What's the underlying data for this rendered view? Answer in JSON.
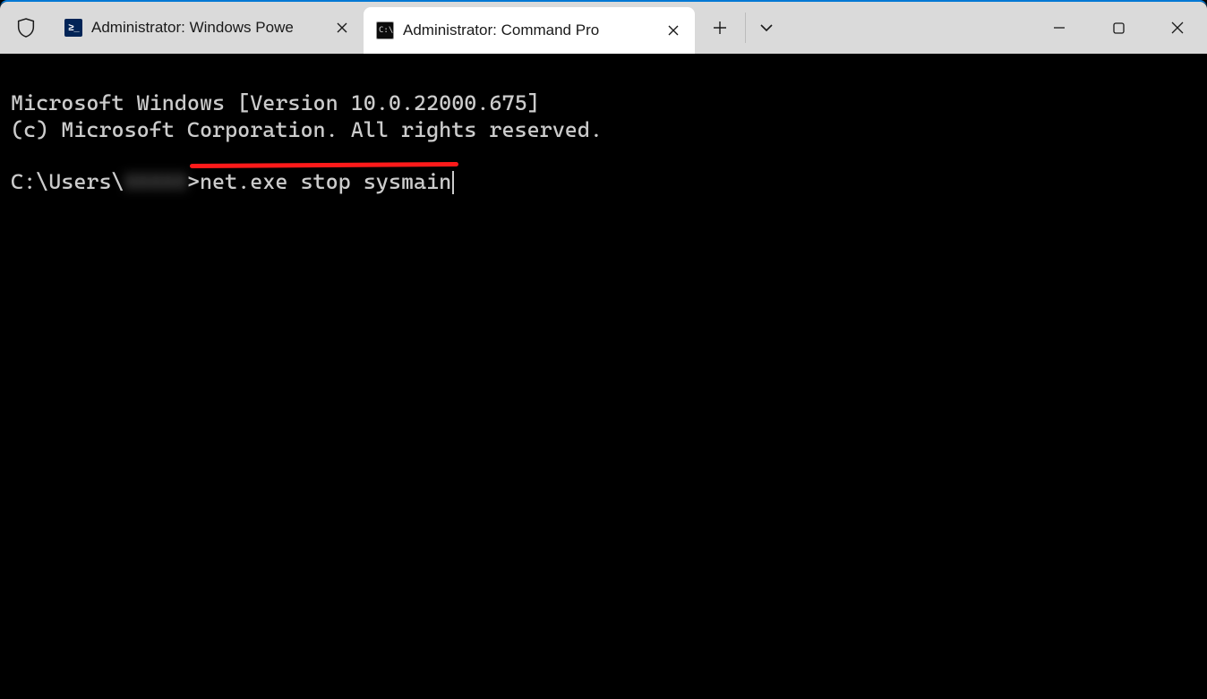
{
  "tabs": [
    {
      "title": "Administrator: Windows Powe",
      "icon": "powershell",
      "active": false
    },
    {
      "title": "Administrator: Command Pro",
      "icon": "cmd",
      "active": true
    }
  ],
  "terminal": {
    "banner_line1": "Microsoft Windows [Version 10.0.22000.675]",
    "banner_line2": "(c) Microsoft Corporation. All rights reserved.",
    "prompt_prefix": "C:\\Users\\",
    "prompt_user_hidden": "XXXXX",
    "prompt_suffix": ">",
    "command": "net.exe stop sysmain"
  },
  "annotation": {
    "underline_color": "#ff1a1a"
  }
}
